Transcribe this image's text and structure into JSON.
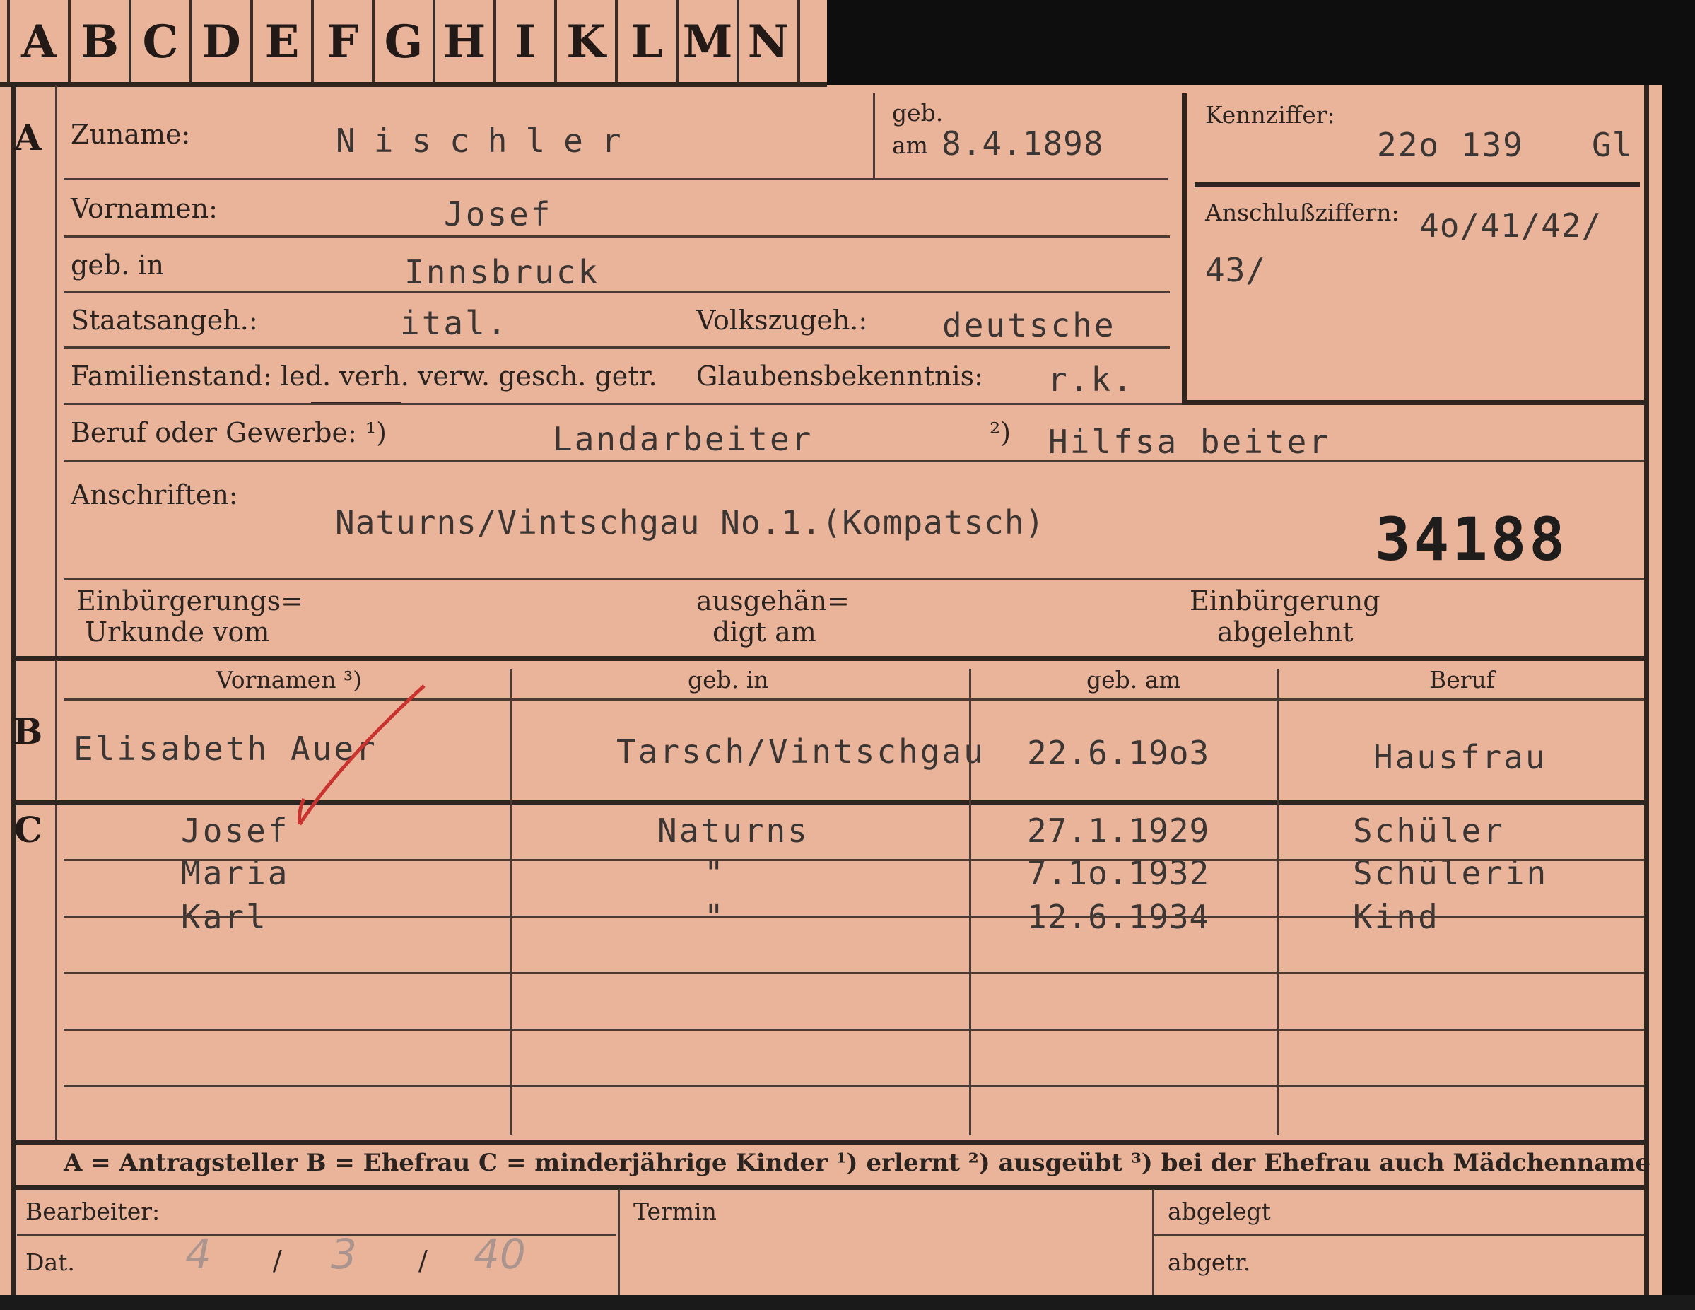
{
  "tabs": [
    "A",
    "B",
    "C",
    "D",
    "E",
    "F",
    "G",
    "H",
    "I",
    "K",
    "L",
    "M",
    "N"
  ],
  "section_a": {
    "marker": "A",
    "zuname_label": "Zuname:",
    "zuname": "Nischler",
    "geb_label_top": "geb.",
    "geb_label_bottom": "am",
    "geb_date": "8.4.1898",
    "vornamen_label": "Vornamen:",
    "vornamen": "Josef",
    "geb_in_label": "geb. in",
    "geb_in": "Innsbruck",
    "staatsangeh_label": "Staatsangeh.:",
    "staatsangeh": "ital.",
    "volkszugeh_label": "Volkszugeh.:",
    "volkszugeh": "deutsche",
    "familienstand_label": "Familienstand: led. verh. verw. gesch. getr.",
    "glaubensbekenntnis_label": "Glaubensbekenntnis:",
    "glaubensbekenntnis": "r.k.",
    "beruf_label": "Beruf oder Gewerbe: ¹)",
    "beruf_1": "Landarbeiter",
    "beruf_2_marker": "²)",
    "beruf_2": "Hilfsa beiter",
    "anschriften_label": "Anschriften:",
    "anschrift": "Naturns/Vintschgau No.1.(Kompatsch)",
    "number": "34188",
    "einbuergerungs_label_1": "Einbürgerungs=",
    "einbuergerungs_label_2": "Urkunde vom",
    "ausgehaendigt_label_1": "ausgehän=",
    "ausgehaendigt_label_2": "digt am",
    "abgelehnt_label_1": "Einbürgerung",
    "abgelehnt_label_2": "abgelehnt"
  },
  "kennziffer": {
    "label": "Kennziffer:",
    "value": "22o 139",
    "suffix": "Gl",
    "anschluss_label": "Anschlußziffern:",
    "anschluss_value_1": "4o/41/42/",
    "anschluss_value_2": "43/"
  },
  "section_b": {
    "marker": "B",
    "headers": [
      "Vornamen ³)",
      "geb. in",
      "geb. am",
      "Beruf"
    ],
    "row": [
      "Elisabeth Auer",
      "Tarsch/Vintschgau",
      "22.6.19o3",
      "Hausfrau"
    ]
  },
  "section_c": {
    "marker": "C",
    "rows": [
      [
        "Josef",
        "Naturns",
        "27.1.1929",
        "Schüler"
      ],
      [
        "Maria",
        "\"",
        "7.1o.1932",
        "Schülerin"
      ],
      [
        "Karl",
        "\"",
        "12.6.1934",
        "Kind"
      ]
    ]
  },
  "legend": {
    "text": "A = Antragsteller   B = Ehefrau   C = minderjährige Kinder   ¹) erlernt   ²) ausgeübt   ³) bei der Ehefrau auch Mädchenname"
  },
  "footer": {
    "bearbeiter_label": "Bearbeiter:",
    "dat_label": "Dat.",
    "dat_day": "4",
    "dat_month": "3",
    "dat_year": "40",
    "dat_sep": "/",
    "termin_label": "Termin",
    "abgelegt_label": "abgelegt",
    "abgetr_label": "abgetr."
  }
}
